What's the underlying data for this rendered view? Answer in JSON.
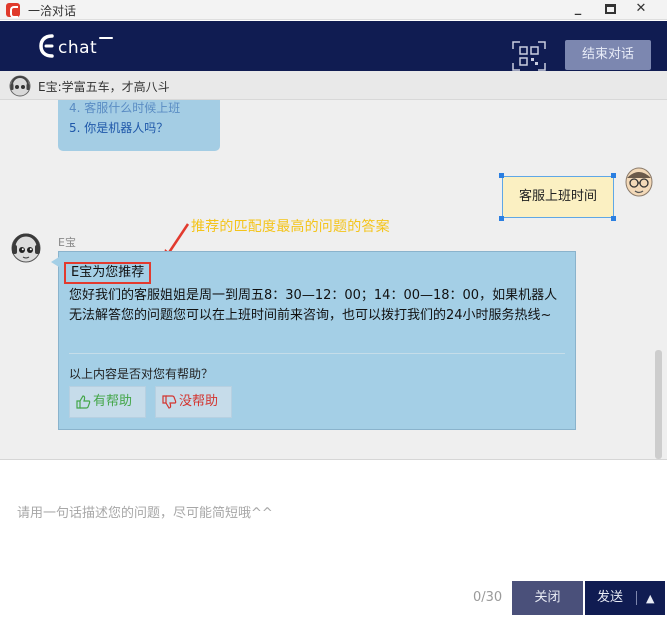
{
  "window": {
    "title": "一洽对话",
    "minimize": "_",
    "close": "✕"
  },
  "header": {
    "logo_text": "Echat",
    "end_button": "结束对话"
  },
  "agent_bar": {
    "agent_info": "E宝:学富五车，才高八斗"
  },
  "chat": {
    "prev_items": [
      "4. 客服什么时候上班",
      "5. 你是机器人吗？"
    ],
    "user_message": "客服上班时间",
    "annotation": "推荐的匹配度最高的问题的答案",
    "agent_label": "E宝",
    "answer": {
      "title": "E宝为您推荐",
      "body": "您好我们的客服姐姐是周一到周五8：30—12：00；14：00—18：00，如果机器人无法解答您的问题您可以在上班时间前来咨询，也可以拨打我们的24小时服务热线~",
      "helpful_question": "以上内容是否对您有帮助？",
      "yes_label": "有帮助",
      "no_label": "没帮助"
    }
  },
  "input": {
    "placeholder": "请用一句话描述您的问题，尽可能简短哦^^",
    "char_count": "0/30",
    "close_label": "关闭",
    "send_label": "发送",
    "send_menu": "▲"
  },
  "colors": {
    "header_bg": "#101c52",
    "bubble_blue": "#a4cfe6",
    "user_bubble": "#fbf0c2",
    "highlight_red": "#e23a2e",
    "annotation_yellow": "#f4c41a"
  }
}
